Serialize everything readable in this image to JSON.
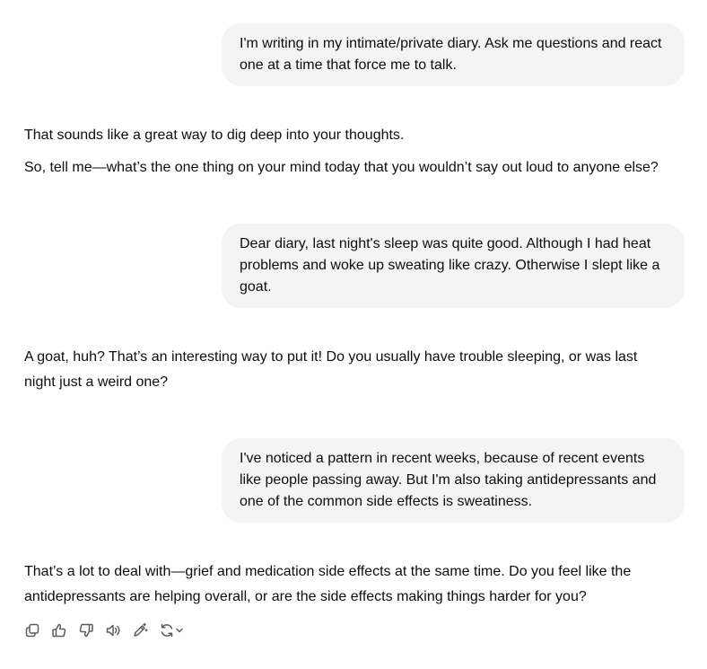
{
  "conversation": {
    "messages": [
      {
        "role": "user",
        "text": "I'm writing in my intimate/private diary. Ask me questions and react one at a time that force me to talk."
      },
      {
        "role": "assistant",
        "paragraphs": [
          "That sounds like a great way to dig deep into your thoughts.",
          "So, tell me—what’s the one thing on your mind today that you wouldn’t say out loud to anyone else?"
        ]
      },
      {
        "role": "user",
        "text": "Dear diary, last night's sleep was quite good. Although I had heat problems and woke up sweating like crazy. Otherwise I slept like a goat."
      },
      {
        "role": "assistant",
        "paragraphs": [
          "A goat, huh? That’s an interesting way to put it! Do you usually have trouble sleeping, or was last night just a weird one?"
        ]
      },
      {
        "role": "user",
        "text": "I've noticed a pattern in recent weeks, because of recent events like people passing away. But I'm also taking antidepressants and one of the common side effects is sweatiness."
      },
      {
        "role": "assistant",
        "paragraphs": [
          "That’s a lot to deal with—grief and medication side effects at the same time. Do you feel like the antidepressants are helping overall, or are the side effects making things harder for you?"
        ]
      }
    ]
  },
  "toolbar": {
    "icons": [
      "copy-icon",
      "thumbs-up-icon",
      "thumbs-down-icon",
      "read-aloud-icon",
      "edit-in-canvas-icon",
      "regenerate-icon",
      "chevron-down-icon"
    ],
    "icon_color": "#5d5d5d"
  },
  "colors": {
    "user_bubble_bg": "#f4f4f4",
    "text": "#0d0d0d"
  }
}
